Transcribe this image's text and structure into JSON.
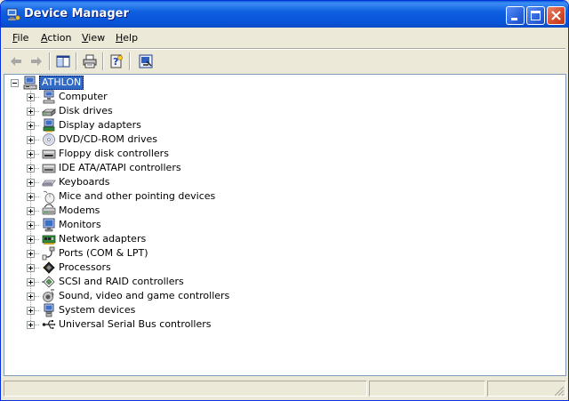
{
  "window": {
    "title": "Device Manager",
    "title_bar_color": "#0A5EDB",
    "selection_color": "#316AC5"
  },
  "title_buttons": [
    {
      "name": "minimize-button",
      "icon": "minimize-icon"
    },
    {
      "name": "maximize-button",
      "icon": "maximize-icon"
    },
    {
      "name": "close-button",
      "icon": "close-icon"
    }
  ],
  "menu": {
    "items": [
      {
        "accel": "F",
        "rest": "ile"
      },
      {
        "accel": "A",
        "rest": "ction"
      },
      {
        "accel": "V",
        "rest": "iew"
      },
      {
        "accel": "H",
        "rest": "elp"
      }
    ]
  },
  "toolbar": {
    "buttons": [
      {
        "name": "back-button",
        "icon": "back-arrow-icon",
        "enabled": false
      },
      {
        "name": "forward-button",
        "icon": "forward-arrow-icon",
        "enabled": false
      },
      {
        "name": "show-hide-console-tree-button",
        "icon": "console-tree-icon",
        "enabled": true
      },
      {
        "name": "print-button",
        "icon": "printer-icon",
        "enabled": true
      },
      {
        "name": "help-button",
        "icon": "help-icon",
        "enabled": true
      },
      {
        "name": "properties-button",
        "icon": "monitor-properties-icon",
        "enabled": true
      }
    ]
  },
  "tree": {
    "root": {
      "label": "ATHLON",
      "icon": "computer-icon",
      "expanded": true,
      "selected": true
    },
    "categories": [
      {
        "label": "Computer",
        "icon": "computer-icon"
      },
      {
        "label": "Disk drives",
        "icon": "disk-drive-icon"
      },
      {
        "label": "Display adapters",
        "icon": "display-adapter-icon"
      },
      {
        "label": "DVD/CD-ROM drives",
        "icon": "cdrom-icon"
      },
      {
        "label": "Floppy disk controllers",
        "icon": "floppy-controller-icon"
      },
      {
        "label": "IDE ATA/ATAPI controllers",
        "icon": "ide-controller-icon"
      },
      {
        "label": "Keyboards",
        "icon": "keyboard-icon"
      },
      {
        "label": "Mice and other pointing devices",
        "icon": "mouse-icon"
      },
      {
        "label": "Modems",
        "icon": "modem-icon"
      },
      {
        "label": "Monitors",
        "icon": "monitor-icon"
      },
      {
        "label": "Network adapters",
        "icon": "network-adapter-icon"
      },
      {
        "label": "Ports (COM & LPT)",
        "icon": "port-icon"
      },
      {
        "label": "Processors",
        "icon": "processor-icon"
      },
      {
        "label": "SCSI and RAID controllers",
        "icon": "scsi-icon"
      },
      {
        "label": "Sound, video and game controllers",
        "icon": "sound-icon"
      },
      {
        "label": "System devices",
        "icon": "system-device-icon"
      },
      {
        "label": "Universal Serial Bus controllers",
        "icon": "usb-icon"
      }
    ]
  },
  "statusbar": {
    "panes": [
      "",
      "",
      ""
    ]
  }
}
